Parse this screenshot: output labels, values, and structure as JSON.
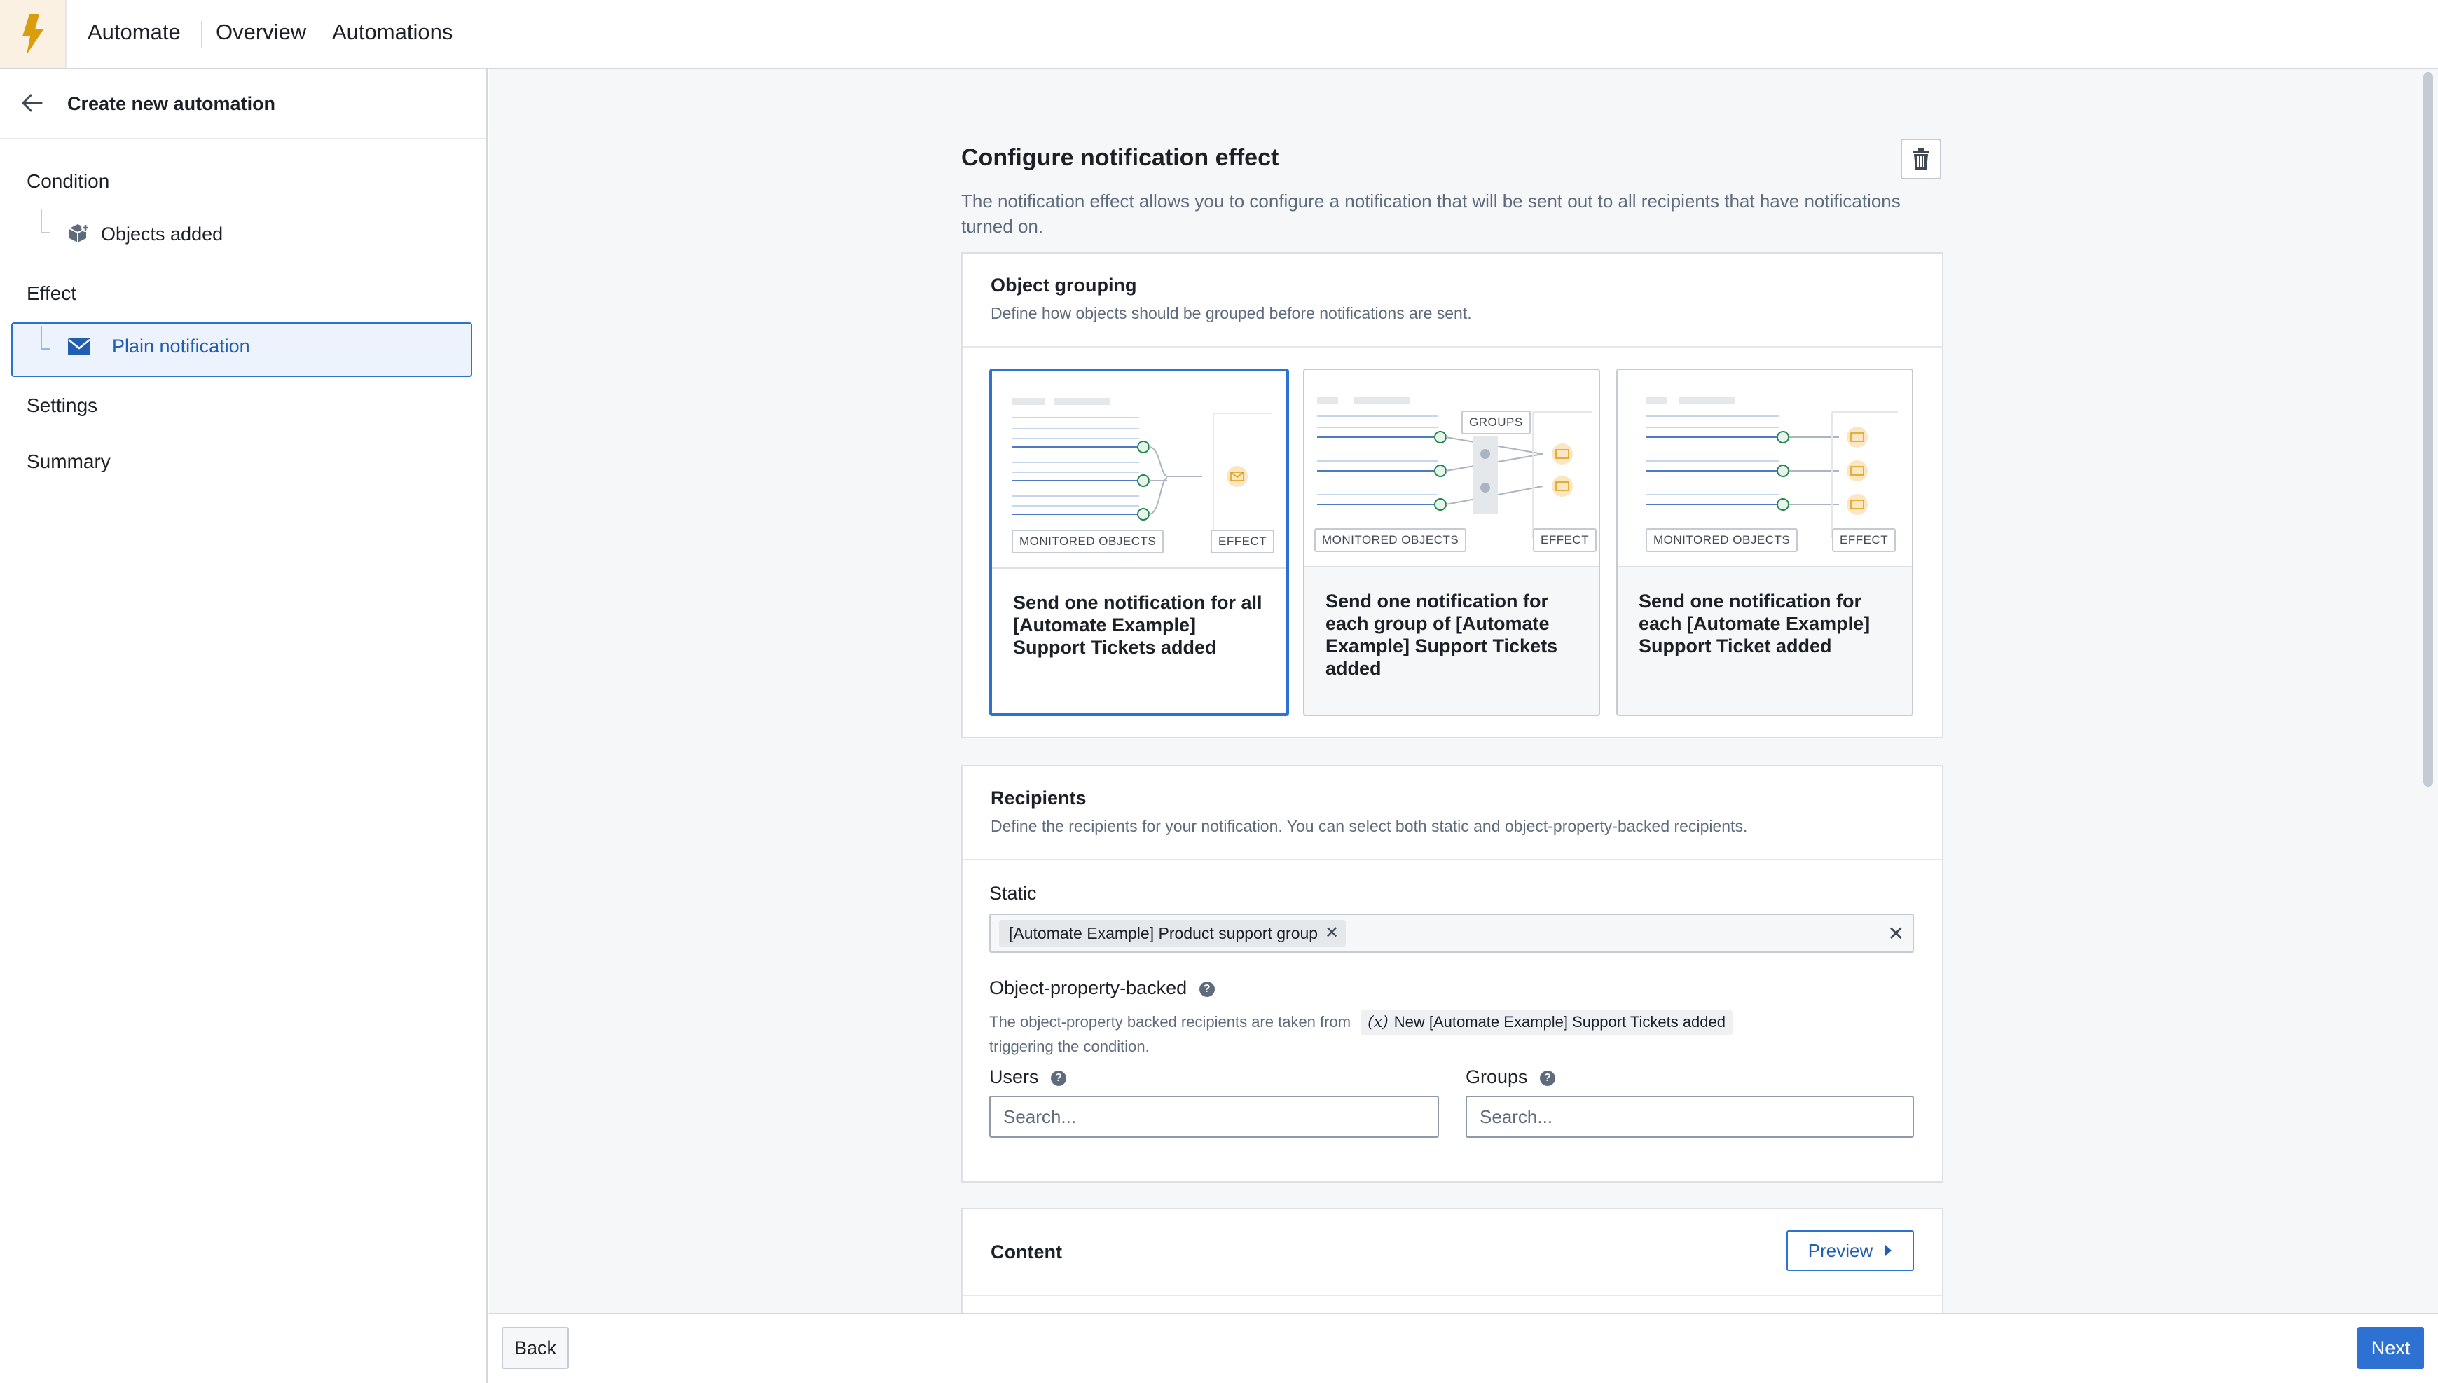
{
  "colors": {
    "accent": "#2d72d2",
    "brand": "#d99e0b"
  },
  "topbar": {
    "app_icon": "lightning-bolt-icon",
    "app_name": "Automate",
    "nav": [
      "Overview",
      "Automations"
    ]
  },
  "sidebar": {
    "back_icon": "arrow-left-icon",
    "title": "Create new automation",
    "sections": {
      "condition": "Condition",
      "condition_item": "Objects added",
      "condition_item_icon": "cube-add-icon",
      "effect": "Effect",
      "effect_item": "Plain notification",
      "effect_item_icon": "envelope-icon",
      "settings": "Settings",
      "summary": "Summary"
    }
  },
  "main": {
    "title": "Configure notification effect",
    "delete_icon": "trash-icon",
    "description": "The notification effect allows you to configure a notification that will be sent out to all recipients that have notifications turned on.",
    "grouping": {
      "title": "Object grouping",
      "subtitle": "Define how objects should be grouped before notifications are sent.",
      "tags": {
        "monitored": "MONITORED OBJECTS",
        "effect": "EFFECT",
        "groups": "GROUPS"
      },
      "selected_index": 0,
      "options": [
        "Send one notification for all [Automate Example] Support Tickets added",
        "Send one notification for each group of [Automate Example] Support Tickets added",
        "Send one notification for each [Automate Example] Support Ticket added"
      ]
    },
    "recipients": {
      "title": "Recipients",
      "subtitle": "Define the recipients for your notification. You can select both static and object-property-backed recipients.",
      "static_label": "Static",
      "static_tag": "[Automate Example] Product support group",
      "object_backed_label": "Object-property-backed",
      "object_backed_desc": "The object-property backed recipients are taken from",
      "object_backed_param": "New [Automate Example] Support Tickets added",
      "object_backed_param_symbol": "(x)",
      "object_backed_desc_end": "triggering the condition.",
      "users_label": "Users",
      "users_placeholder": "Search...",
      "groups_label": "Groups",
      "groups_placeholder": "Search..."
    },
    "content": {
      "title": "Content",
      "preview_label": "Preview"
    }
  },
  "footer": {
    "back_label": "Back",
    "next_label": "Next"
  }
}
